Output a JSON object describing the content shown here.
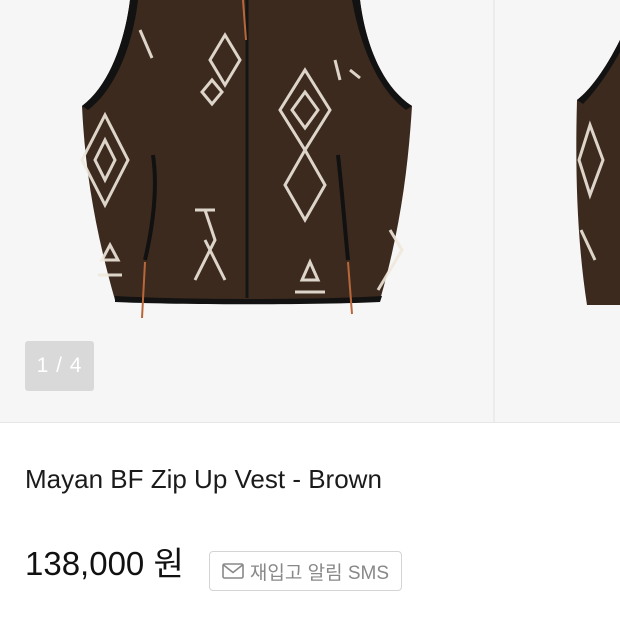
{
  "carousel": {
    "counter": "1 / 4",
    "images": [
      {
        "icon": "fleece-vest-product-image"
      },
      {
        "icon": "fleece-vest-product-image-next"
      }
    ],
    "colors": {
      "fabric": "#3d2a1e",
      "pattern": "#efe8dc",
      "trim": "#121212",
      "pull": "#b8673a"
    }
  },
  "product": {
    "title": "Mayan BF Zip Up Vest - Brown",
    "price": "138,000 원"
  },
  "restock": {
    "label": "재입고 알림 SMS",
    "icon": "mail-icon"
  }
}
